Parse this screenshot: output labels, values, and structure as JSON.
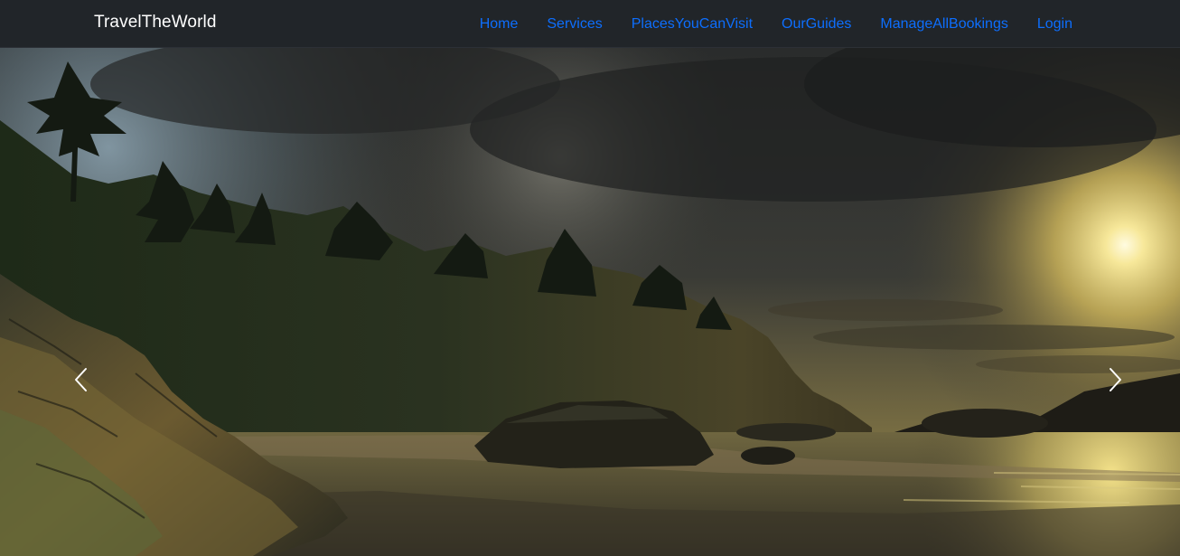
{
  "navbar": {
    "brand": "TravelTheWorld",
    "links": [
      {
        "label": "Home"
      },
      {
        "label": "Services"
      },
      {
        "label": "PlacesYouCanVisit"
      },
      {
        "label": "OurGuides"
      },
      {
        "label": "ManageAllBookings"
      },
      {
        "label": "Login"
      }
    ]
  },
  "carousel": {
    "prev_icon": "chevron-left-icon",
    "next_icon": "chevron-right-icon",
    "slide_description_icon": "coastal-sunset-image"
  },
  "colors": {
    "navbar_bg": "#212529",
    "link": "#0d6efd",
    "brand": "#ffffff"
  }
}
